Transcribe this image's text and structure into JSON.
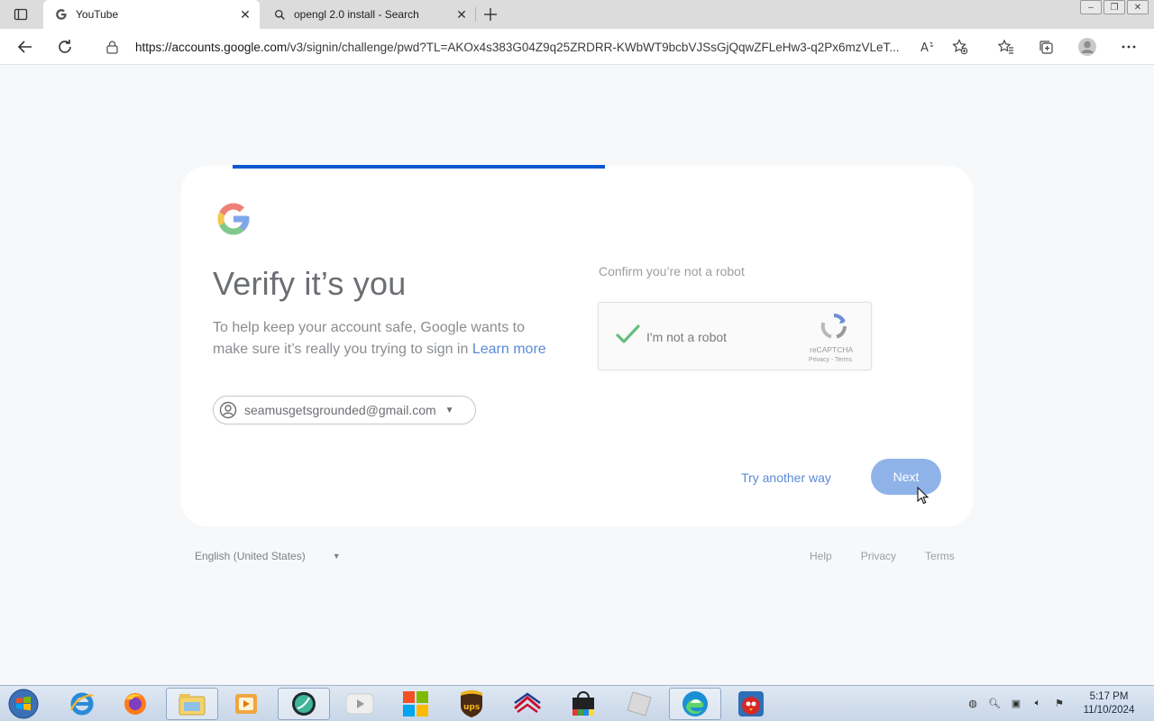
{
  "browser": {
    "tabs": [
      {
        "title": "YouTube",
        "active": true,
        "icon": "google-g-icon"
      },
      {
        "title": "opengl 2.0 install - Search",
        "active": false,
        "icon": "search-icon"
      }
    ],
    "address_host": "https://accounts.google.com",
    "address_path": "/v3/signin/challenge/pwd?TL=AKOx4s383G04Z9q25ZRDRR-KWbWT9bcbVJSsGjQqwZFLeHw3-q2Px6mzVLeT..."
  },
  "signin": {
    "heading": "Verify it’s you",
    "description": "To help keep your account safe, Google wants to make sure it’s really you trying to sign in",
    "learn_more": "Learn more",
    "account_email": "seamusgetsgrounded@gmail.com",
    "robot_label": "Confirm you’re not a robot",
    "recaptcha_label": "I'm not a robot",
    "recaptcha_brand": "reCAPTCHA",
    "recaptcha_links": "Privacy - Terms",
    "recaptcha_checked": true,
    "try_another_way": "Try another way",
    "next": "Next",
    "progress": 0.47
  },
  "footer": {
    "language": "English (United States)",
    "links": [
      "Help",
      "Privacy",
      "Terms"
    ]
  },
  "taskbar": {
    "time": "5:17 PM",
    "date": "11/10/2024"
  },
  "colors": {
    "accent": "#0b57d0",
    "next_button": "#8fb2e8",
    "link": "#5b8ad8",
    "check": "#34a853"
  }
}
